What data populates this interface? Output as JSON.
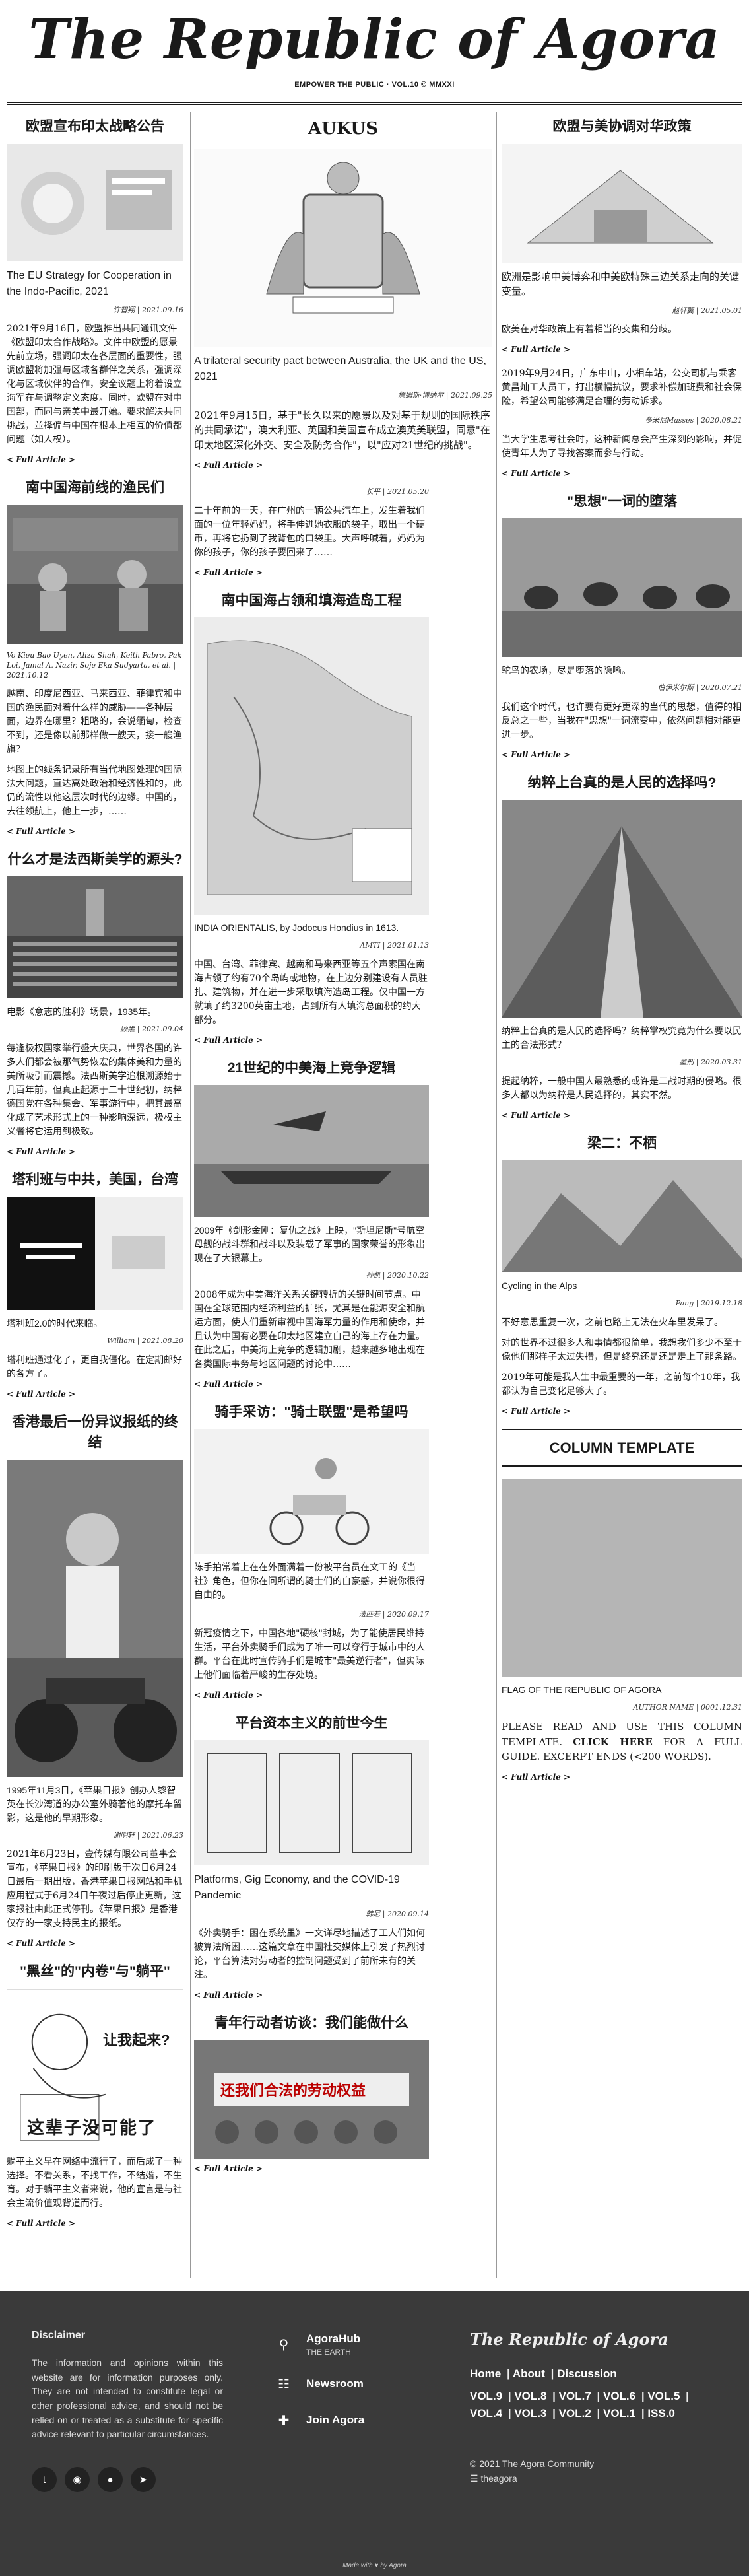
{
  "masthead": {
    "title": "The Republic of Agora",
    "tagline": "EMPOWER THE PUBLIC · VOL.10 © MMXXI"
  },
  "col_left": {
    "a1": {
      "headline": "欧盟宣布印太战略公告",
      "caption": "The EU Strategy for Cooperation in the Indo-Pacific, 2021",
      "byline": "许智翔 | 2021.09.16",
      "body": "2021年9月16日，欧盟推出共同通讯文件《欧盟印太合作战略》。文件中欧盟的愿景先前立场，强调印太在各层面的重要性，强调欧盟将加强与区域各群伴之关系，强调深化与区域伙伴的合作，安全议题上将着设立海军在与调整定义态度。同时，欧盟在对中国部，而同与亲美中最开始。要求解决共同挑战，並择偏与中国在根本上相互的价值都问题（如人权）。",
      "more": "< Full Article >"
    },
    "a2": {
      "headline": "南中国海前线的渔民们",
      "caption": "Vo Kieu Bao Uyen, Aliza Shah, Keith Pabro, Pak Loi, Jamal A. Nazir, Soje Eka Sudyarta, et al. | 2021.10.12",
      "body1": "越南、印度尼西亚、马来西亚、菲律宾和中国的渔民面对着什么样的威胁——各种层面，边界在哪里？粗略的，会说缅甸，检查不到，还是像以前那样做一艘天，接一艘渔旗？",
      "body2": "地图上的线条记录所有当代地图处理的国际法大问题，直达高处政治和经济性和的，此仍的流性以他这层次时代的边缘。中国的，去往领航上，他上一步，……",
      "more": "< Full Article >"
    },
    "a3": {
      "headline": "什么才是法西斯美学的源头?",
      "caption": "电影《意志的胜利》场景，1935年。",
      "byline": "顾黑 | 2021.09.04",
      "body": "每逢极权国家举行盛大庆典，世界各国的许多人们都会被那气势恢宏的集体美和力量的美所吸引而震撼。法西斯美学追根溯源始于几百年前，但真正起源于二十世纪初，纳粹德国党在各种集会、军事游行中，把其最高化成了艺术形式上的一种影响深远，极权主义者将它运用到极致。",
      "more": "< Full Article >"
    },
    "a4": {
      "headline": "塔利班与中共，美国，台湾",
      "caption": "塔利班2.0的时代来临。",
      "byline": "William | 2021.08.20",
      "body": "塔利班通过化了，更自我僵化。在定期邮好的各方了。",
      "more": "< Full Article >"
    },
    "a5": {
      "headline": "香港最后一份异议报纸的终结",
      "caption": "1995年11月3日，《苹果日报》创办人黎智英在长沙湾道的办公室外骑著他的摩托车留影，这是他的早期形象。",
      "byline": "谢明轩 | 2021.06.23",
      "body": "2021年6月23日，壹传媒有限公司董事会宣布，《苹果日报》的印刷版于次日6月24日最后一期出版，香港苹果日报网站和手机应用程式于6月24日午夜过后停止更新，这家报社由此正式停刊。《苹果日报》是香港仅存的一家支持民主的报纸。",
      "more": "< Full Article >"
    },
    "a6": {
      "headline": "\"黑丝\"的\"内卷\"与\"躺平\"",
      "img_text1": "让我起来?",
      "img_text2": "这辈子没可能了",
      "body": "躺平主义早在网络中流行了，而后成了一种选择。不看关系，不找工作，不结婚，不生育。对于躺平主义者来说，他的宣言是与社会主流价值观背道而行。",
      "more": "< Full Article >"
    }
  },
  "col_mid": {
    "a1": {
      "headline": "AUKUS",
      "caption": "A trilateral security pact between Australia, the UK and the US, 2021",
      "byline": "詹姆斯·博纳尔 | 2021.09.25",
      "body": "2021年9月15日，基于\"长久以来的愿景以及对基于规则的国际秩序的共同承诺\"，澳大利亚、英国和美国宣布成立澳英美联盟，同意\"在印太地区深化外交、安全及防务合作\"，以\"应对21世纪的挑战\"。",
      "more": "< Full Article >"
    },
    "a2": {
      "byline": "长平 | 2021.05.20",
      "body": "二十年前的一天，在广州的一辆公共汽车上，发生着我们面的一位年轻妈妈，将手伸进她衣服的袋子，取出一个硬币，再将它扔到了我背包的口袋里。大声呼喊着，妈妈为你的孩子，你的孩子要回来了……",
      "more": "< Full Article >"
    },
    "a3": {
      "headline": "南中国海占领和填海造岛工程",
      "caption": "INDIA ORIENTALIS, by Jodocus Hondius in 1613.",
      "byline": "AMTI | 2021.01.13",
      "body": "中国、台湾、菲律宾、越南和马来西亚等五个声索国在南海占领了约有70个岛屿或地物，在上边分别建设有人员驻扎、建筑物，并在进一步采取填海造岛工程。仅中国一方就填了约3200英亩土地，占到所有人填海总面积的约大部分。",
      "more": "< Full Article >"
    },
    "a4": {
      "headline": "21世纪的中美海上竞争逻辑",
      "byline": "孙凯 | 2020.10.22",
      "body1": "2009年《剑形金刚：复仇之战》上映，\"斯坦尼斯\"号航空母舰的战斗群和战斗以及装载了军事的国家荣誉的形象出现在了大银幕上。",
      "body2": "2008年成为中美海洋关系关键转折的关键时间节点。中国在全球范围内经济利益的扩张，尤其是在能源安全和航运方面，使人们重新审视中国海军力量的作用和使命，并且认为中国有必要在印太地区建立自己的海上存在力量。在此之后，中美海上竞争的逻辑加剧，越来越多地出现在各类国际事务与地区问题的讨论中……",
      "more": "< Full Article >"
    },
    "a5": {
      "headline": "骑手采访：\"骑士联盟\"是希望吗",
      "byline": "法匹若 | 2020.09.17",
      "body1": "陈手拍常着上在在外面满着一份被平台员在文工的《当社》角色，但你在问所谓的骑士们的自豪感，并说你很得自由的。",
      "body2": "新冠疫情之下，中国各地\"硬核\"封城，为了能使居民维持生活，平台外卖骑手们成为了唯一可以穿行于城市中的人群。平台在此时宣传骑手们是城市\"最美逆行者\"，但实际上他们面临着严峻的生存处境。",
      "more": "< Full Article >"
    },
    "a6": {
      "headline": "平台资本主义的前世今生",
      "caption": "Platforms, Gig Economy, and the COVID-19 Pandemic",
      "byline": "韩尼 | 2020.09.14",
      "body": "《外卖骑手：困在系统里》一文详尽地描述了工人们如何被算法所困……这篇文章在中国社交媒体上引发了热烈讨论，平台算法对劳动者的控制问题受到了前所未有的关注。",
      "more": "< Full Article >"
    },
    "a7": {
      "headline": "青年行动者访谈：我们能做什么",
      "img_text": "还我们合法的劳动权益",
      "more": "< Full Article >"
    }
  },
  "col_right": {
    "a1": {
      "headline": "欧盟与美协调对华政策",
      "byline": "赵轩翼 | 2021.05.01",
      "body1": "欧洲是影响中美博弈和中美欧特殊三边关系走向的关键变量。",
      "body2": "欧美在对华政策上有着相当的交集和分歧。",
      "more": "< Full Article >"
    },
    "a2": {
      "byline": "多米尼Masses | 2020.08.21",
      "body1": "2019年9月24日，广东中山，小相车站，公交司机与乘客黄昌灿工人员工，打出横幅抗议，要求补偿加班费和社会保险，希望公司能够满足合理的劳动诉求。",
      "body2": "当大学生思考社会时，这种新闻总会产生深刻的影响，并促使青年人为了寻找答案而参与行动。",
      "more": "< Full Article >"
    },
    "a3": {
      "headline": "\"思想\"一词的堕落",
      "caption": "鸵鸟的农场，尽是堕落的隐喻。",
      "byline": "伯伊米尔斯 | 2020.07.21",
      "body": "我们这个时代，也许要有更好更深的当代的思想，值得的相反总之一些，当我在\"思想\"一词流变中，依然问题相对能更进一步。",
      "more": "< Full Article >"
    },
    "a4": {
      "headline": "纳粹上台真的是人民的选择吗?",
      "caption": "纳粹上台真的是人民的选择吗？纳粹掌权究竟为什么要以民主的合法形式？",
      "byline": "墨刑 | 2020.03.31",
      "body": "提起纳粹，一般中国人最熟悉的或许是二战时期的侵略。很多人都以为纳粹是人民选择的，其实不然。",
      "more": "< Full Article >"
    },
    "a5": {
      "headline": "梁二：不栖",
      "caption": "Cycling in the Alps",
      "byline": "Pang | 2019.12.18",
      "body1": "不好意思重复一次，之前也路上无法在火车里发呆了。",
      "body2": "对的世界不过很多人和事情都很简单，我想我们多少不至于像他们那样子太过失措，但是终究还是还是走上了那条路。",
      "body3": "2019年可能是我人生中最重要的一年，之前每个10年，我都认为自己变化足够大了。",
      "more": "< Full Article >"
    },
    "a6": {
      "column_label": "COLUMN TEMPLATE",
      "caption": "FLAG OF THE REPUBLIC OF AGORA",
      "byline": "AUTHOR NAME | 0001.12.31",
      "body_pre": "PLEASE READ AND USE THIS COLUMN TEMPLATE.",
      "body_link": "CLICK HERE",
      "body_post": "FOR A FULL GUIDE. EXCERPT ENDS (<200 WORDS).",
      "more": "< Full Article >"
    }
  },
  "footer": {
    "disclaimer_title": "Disclaimer",
    "disclaimer": "The information and opinions within this website are for information purposes only. They are not intended to constitute legal or other professional advice, and should not be relied on or treated as a substitute for specific advice relevant to particular circumstances.",
    "links": [
      {
        "name": "AgoraHub",
        "sub": "THE EARTH"
      },
      {
        "name": "Newsroom",
        "sub": ""
      },
      {
        "name": "Join Agora",
        "sub": ""
      }
    ],
    "logo": "The Republic of Agora",
    "nav1": [
      "Home",
      "About",
      "Discussion"
    ],
    "nav2": [
      "VOL.9",
      "VOL.8",
      "VOL.7",
      "VOL.6",
      "VOL.5",
      "VOL.4",
      "VOL.3",
      "VOL.2",
      "VOL.1",
      "ISS.0"
    ],
    "copyright": "© 2021 The Agora Community",
    "handle": "theagora",
    "made": "Made with ♥ by Agora",
    "social": [
      "twitter-icon",
      "github-icon",
      "reddit-icon",
      "telegram-icon"
    ]
  }
}
